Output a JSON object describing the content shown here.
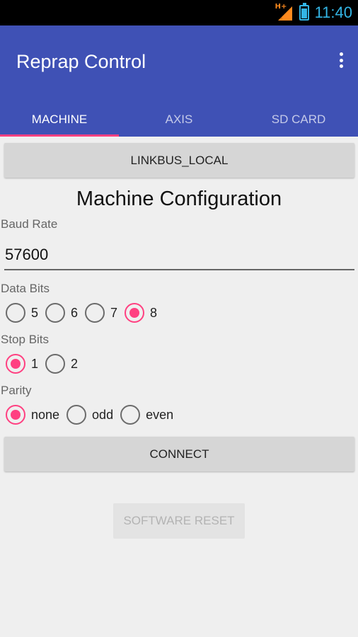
{
  "status_bar": {
    "network_type": "H+",
    "time": "11:40"
  },
  "app_bar": {
    "title": "Reprap Control",
    "overflow_icon": "more-vert-icon"
  },
  "tabs": [
    {
      "label": "MACHINE",
      "active": true
    },
    {
      "label": "AXIS",
      "active": false
    },
    {
      "label": "SD CARD",
      "active": false
    }
  ],
  "link_button": {
    "label": "LINKBUS_LOCAL"
  },
  "machine_config": {
    "title": "Machine Configuration",
    "baud_rate": {
      "label": "Baud Rate",
      "value": "57600"
    },
    "data_bits": {
      "label": "Data Bits",
      "options": [
        "5",
        "6",
        "7",
        "8"
      ],
      "selected": "8"
    },
    "stop_bits": {
      "label": "Stop Bits",
      "options": [
        "1",
        "2"
      ],
      "selected": "1"
    },
    "parity": {
      "label": "Parity",
      "options": [
        "none",
        "odd",
        "even"
      ],
      "selected": "none"
    }
  },
  "connect_button": {
    "label": "CONNECT"
  },
  "software_reset_button": {
    "label": "SOFTWARE RESET",
    "enabled": false
  },
  "colors": {
    "primary": "#3f51b5",
    "accent": "#ff4081",
    "status_accent": "#33b5e5"
  }
}
